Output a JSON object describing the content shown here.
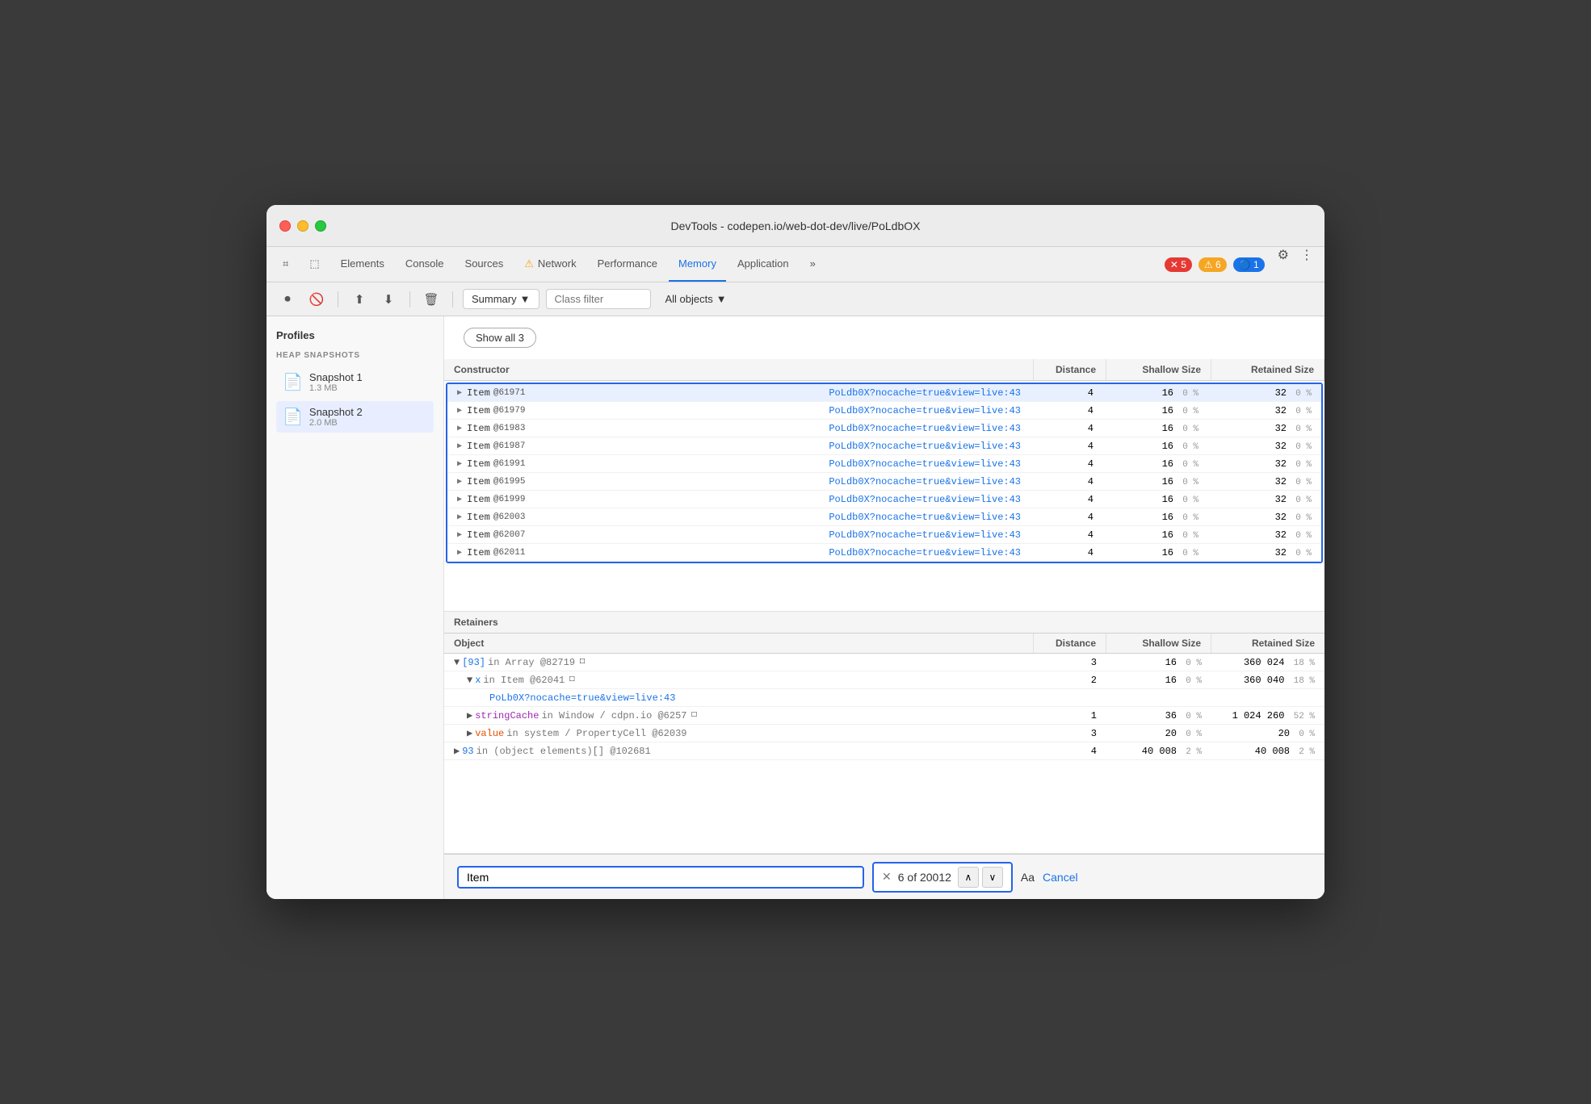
{
  "window": {
    "title": "DevTools - codepen.io/web-dot-dev/live/PoLdbOX"
  },
  "tabs": [
    {
      "id": "cursor",
      "label": "⌗",
      "active": false
    },
    {
      "id": "inspector",
      "label": "□",
      "active": false
    },
    {
      "id": "elements",
      "label": "Elements",
      "active": false
    },
    {
      "id": "console",
      "label": "Console",
      "active": false
    },
    {
      "id": "sources",
      "label": "Sources",
      "active": false
    },
    {
      "id": "network",
      "label": "Network",
      "active": false,
      "warning": true
    },
    {
      "id": "performance",
      "label": "Performance",
      "active": false
    },
    {
      "id": "memory",
      "label": "Memory",
      "active": true
    },
    {
      "id": "application",
      "label": "Application",
      "active": false
    }
  ],
  "badges": {
    "error": "5",
    "warning": "6",
    "info": "1"
  },
  "toolbar": {
    "summary_label": "Summary",
    "class_filter_placeholder": "Class filter",
    "all_objects_label": "All objects"
  },
  "sidebar": {
    "title": "Profiles",
    "section_title": "HEAP SNAPSHOTS",
    "snapshots": [
      {
        "id": 1,
        "name": "Snapshot 1",
        "size": "1.3 MB",
        "active": false
      },
      {
        "id": 2,
        "name": "Snapshot 2",
        "size": "2.0 MB",
        "active": true
      }
    ]
  },
  "upper_table": {
    "columns": [
      "Constructor",
      "Distance",
      "Shallow Size",
      "Retained Size"
    ],
    "show_all_label": "Show all 3",
    "rows": [
      {
        "id": "61971",
        "name": "Item",
        "link": "PoLdb0X?nocache=true&view=live:43",
        "distance": "4",
        "shallow": "16",
        "shallow_pct": "0 %",
        "retained": "32",
        "retained_pct": "0 %",
        "highlighted": true
      },
      {
        "id": "61979",
        "name": "Item",
        "link": "PoLdb0X?nocache=true&view=live:43",
        "distance": "4",
        "shallow": "16",
        "shallow_pct": "0 %",
        "retained": "32",
        "retained_pct": "0 %"
      },
      {
        "id": "61983",
        "name": "Item",
        "link": "PoLdb0X?nocache=true&view=live:43",
        "distance": "4",
        "shallow": "16",
        "shallow_pct": "0 %",
        "retained": "32",
        "retained_pct": "0 %"
      },
      {
        "id": "61987",
        "name": "Item",
        "link": "PoLdb0X?nocache=true&view=live:43",
        "distance": "4",
        "shallow": "16",
        "shallow_pct": "0 %",
        "retained": "32",
        "retained_pct": "0 %"
      },
      {
        "id": "61991",
        "name": "Item",
        "link": "PoLdb0X?nocache=true&view=live:43",
        "distance": "4",
        "shallow": "16",
        "shallow_pct": "0 %",
        "retained": "32",
        "retained_pct": "0 %"
      },
      {
        "id": "61995",
        "name": "Item",
        "link": "PoLdb0X?nocache=true&view=live:43",
        "distance": "4",
        "shallow": "16",
        "shallow_pct": "0 %",
        "retained": "32",
        "retained_pct": "0 %"
      },
      {
        "id": "61999",
        "name": "Item",
        "link": "PoLdb0X?nocache=true&view=live:43",
        "distance": "4",
        "shallow": "16",
        "shallow_pct": "0 %",
        "retained": "32",
        "retained_pct": "0 %"
      },
      {
        "id": "62003",
        "name": "Item",
        "link": "PoLdb0X?nocache=true&view=live:43",
        "distance": "4",
        "shallow": "16",
        "shallow_pct": "0 %",
        "retained": "32",
        "retained_pct": "0 %"
      },
      {
        "id": "62007",
        "name": "Item",
        "link": "PoLdb0X?nocache=true&view=live:43",
        "distance": "4",
        "shallow": "16",
        "shallow_pct": "0 %",
        "retained": "32",
        "retained_pct": "0 %"
      },
      {
        "id": "62011",
        "name": "Item",
        "link": "PoLdb0X?nocache=true&view=live:43",
        "distance": "4",
        "shallow": "16",
        "shallow_pct": "0 %",
        "retained": "32",
        "retained_pct": "0 %",
        "partial": true
      }
    ]
  },
  "retainers": {
    "title": "Retainers",
    "columns": [
      "Object",
      "Distance",
      "Shallow Size",
      "Retained Size"
    ],
    "rows": [
      {
        "indent": 0,
        "arrow": "▼",
        "text": "[93] in Array @82719",
        "icon": "□",
        "distance": "3",
        "shallow": "16",
        "shallow_pct": "0 %",
        "retained": "360 024",
        "retained_pct": "18 %"
      },
      {
        "indent": 1,
        "arrow": "▼",
        "text": "x in Item @62041",
        "icon": "□",
        "distance": "2",
        "shallow": "16",
        "shallow_pct": "0 %",
        "retained": "360 040",
        "retained_pct": "18 %"
      },
      {
        "indent": 2,
        "arrow": "",
        "text": "PoLb0X?nocache=true&view=live:43",
        "link": true,
        "distance": "",
        "shallow": "",
        "shallow_pct": "",
        "retained": "",
        "retained_pct": ""
      },
      {
        "indent": 1,
        "arrow": "▶",
        "text": "stringCache in Window / cdpn.io @6257",
        "icon": "□",
        "distance": "1",
        "shallow": "36",
        "shallow_pct": "0 %",
        "retained": "1 024 260",
        "retained_pct": "52 %"
      },
      {
        "indent": 1,
        "arrow": "▶",
        "text": "value in system / PropertyCell @62039",
        "distance": "3",
        "shallow": "20",
        "shallow_pct": "0 %",
        "retained": "20",
        "retained_pct": "0 %"
      },
      {
        "indent": 0,
        "arrow": "▶",
        "text": "93 in (object elements)[] @102681",
        "distance": "4",
        "shallow": "40 008",
        "shallow_pct": "2 %",
        "retained": "40 008",
        "retained_pct": "2 %"
      }
    ]
  },
  "search": {
    "input_value": "Item",
    "result_text": "6 of 20012",
    "aa_label": "Aa",
    "cancel_label": "Cancel"
  }
}
